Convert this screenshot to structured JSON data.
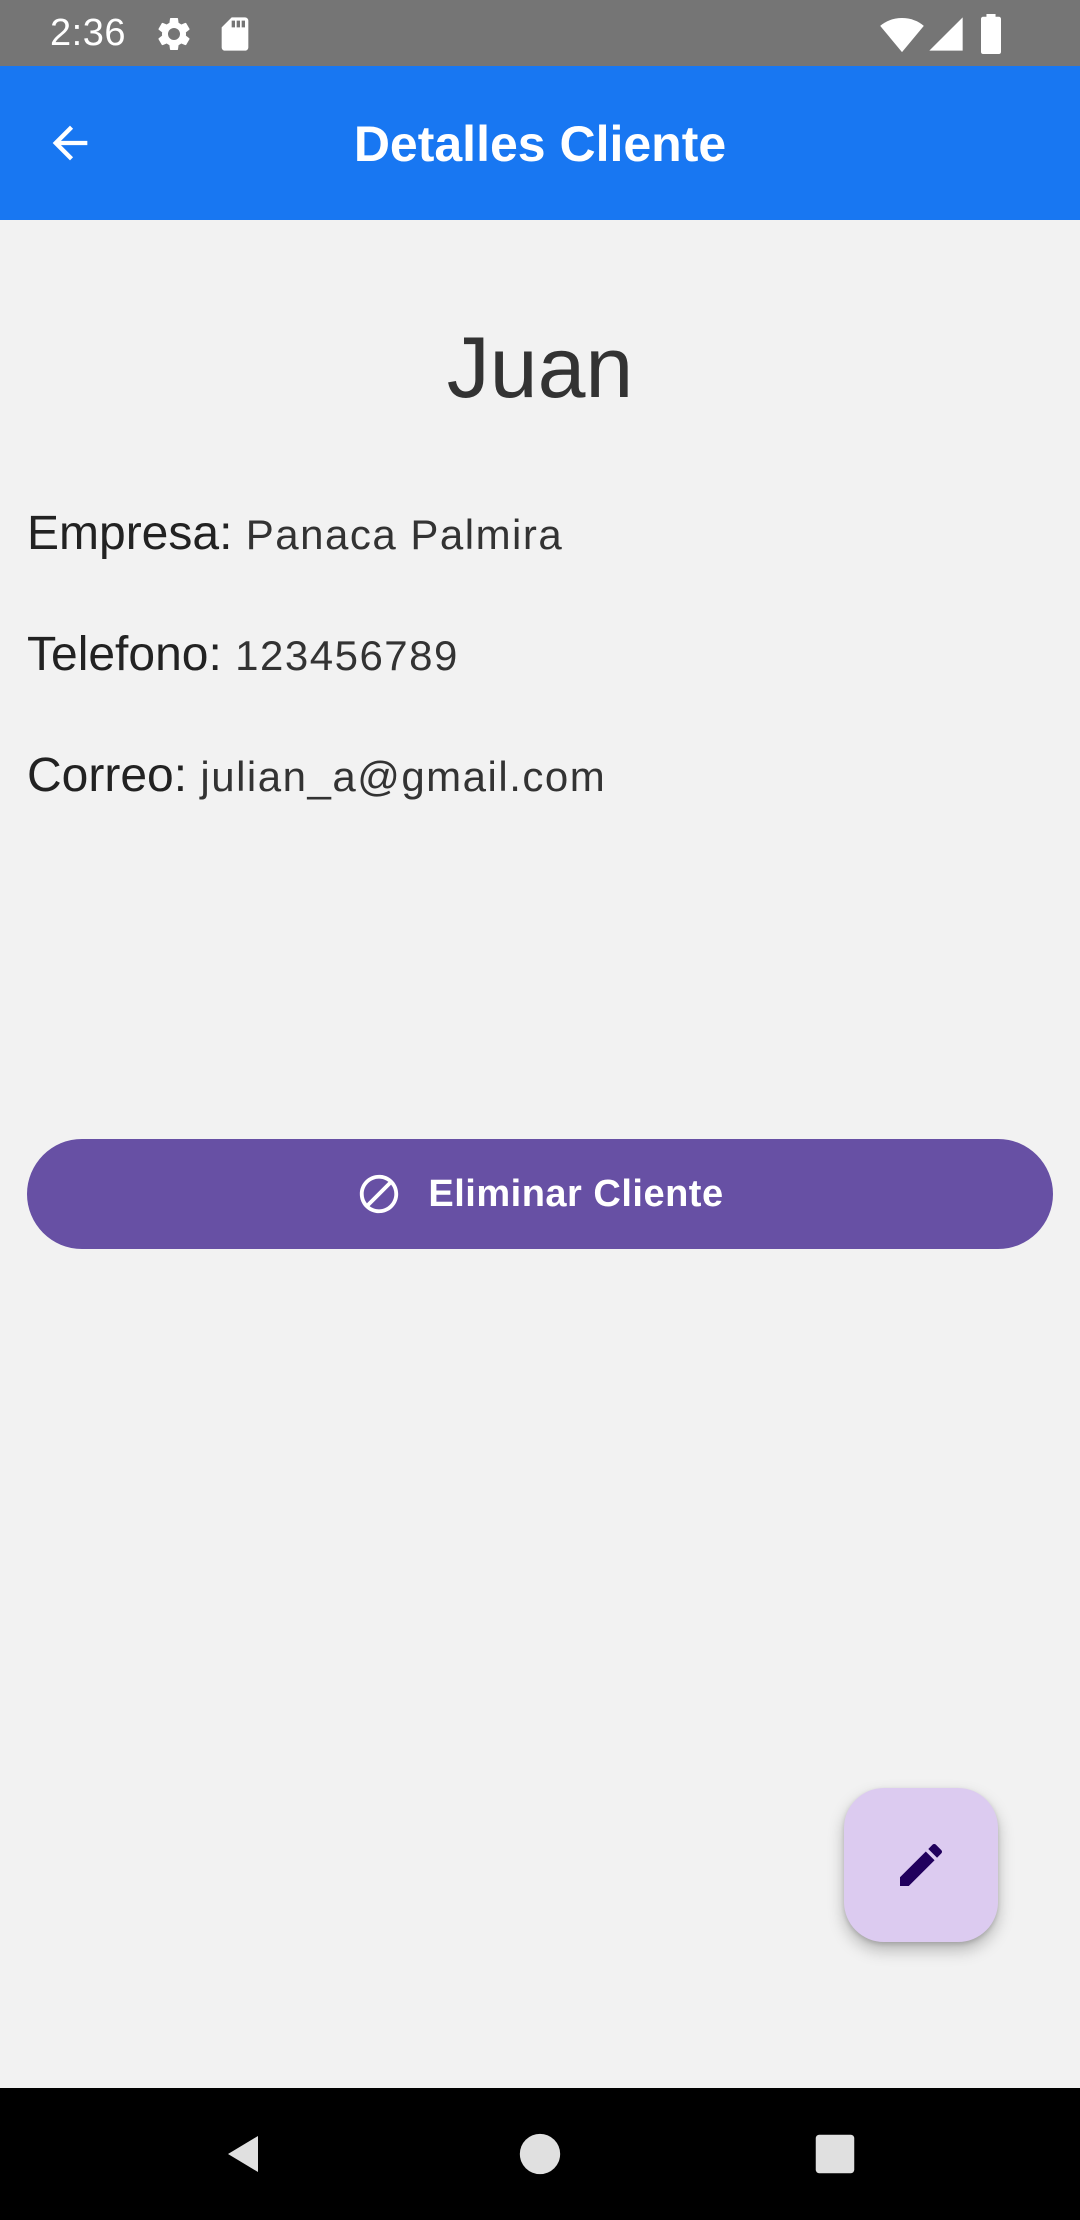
{
  "status_bar": {
    "time": "2:36",
    "icons": [
      "settings-icon",
      "sd-card-icon",
      "wifi-icon",
      "signal-icon",
      "battery-icon"
    ]
  },
  "app_bar": {
    "title": "Detalles Cliente",
    "back_icon": "arrow-back-icon",
    "background_color": "#1877f2"
  },
  "client": {
    "name": "Juan",
    "fields": [
      {
        "label": "Empresa:",
        "value": "Panaca Palmira"
      },
      {
        "label": "Telefono:",
        "value": "123456789"
      },
      {
        "label": "Correo:",
        "value": "julian_a@gmail.com"
      }
    ]
  },
  "actions": {
    "delete_label": "Eliminar Cliente",
    "delete_icon": "block-icon",
    "delete_color": "#6750a4",
    "edit_icon": "edit-pencil-icon",
    "fab_color": "#dccbf0"
  },
  "nav_bar": {
    "buttons": [
      "back-triangle-icon",
      "home-circle-icon",
      "recents-square-icon"
    ]
  }
}
